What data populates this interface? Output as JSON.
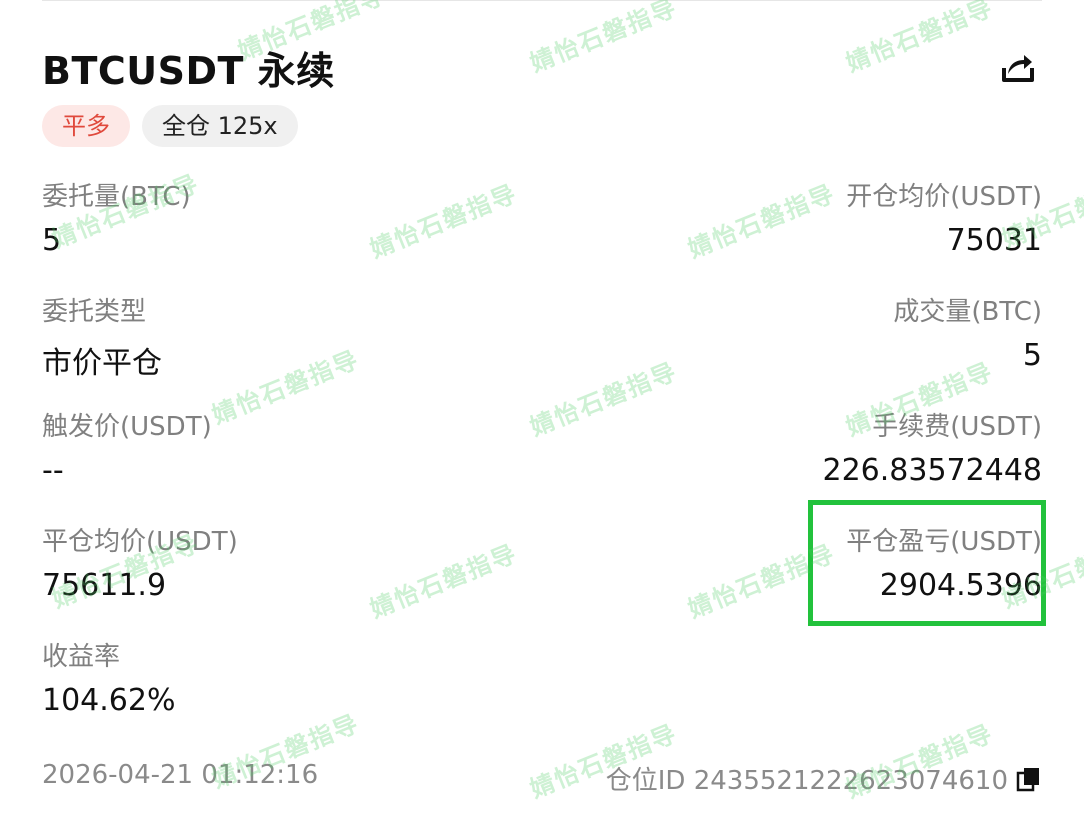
{
  "header": {
    "title": "BTCUSDT 永续",
    "share_icon": "share-icon"
  },
  "tags": {
    "direction": "平多",
    "margin": "全仓 125x"
  },
  "fields": {
    "order_qty": {
      "label": "委托量(BTC)",
      "value": "5"
    },
    "open_avg_price": {
      "label": "开仓均价(USDT)",
      "value": "75031"
    },
    "order_type": {
      "label": "委托类型",
      "value": "市价平仓"
    },
    "filled_qty": {
      "label": "成交量(BTC)",
      "value": "5"
    },
    "trigger_price": {
      "label": "触发价(USDT)",
      "value": "--"
    },
    "fee": {
      "label": "手续费(USDT)",
      "value": "226.83572448"
    },
    "close_avg_price": {
      "label": "平仓均价(USDT)",
      "value": "75611.9"
    },
    "close_pnl": {
      "label": "平仓盈亏(USDT)",
      "value": "2904.5396"
    },
    "roi": {
      "label": "收益率",
      "value": "104.62%"
    }
  },
  "footer": {
    "timestamp": "2026-04-21 01:12:16",
    "position_id": "仓位ID 2435521222623074610",
    "copy_icon": "copy-icon"
  },
  "watermark": {
    "text": "婧怡石磐指导"
  },
  "colors": {
    "tag_red_bg": "#fde8e6",
    "tag_red_text": "#e0493c",
    "highlight_green": "#22c23c",
    "watermark_green": "#50cd64"
  }
}
